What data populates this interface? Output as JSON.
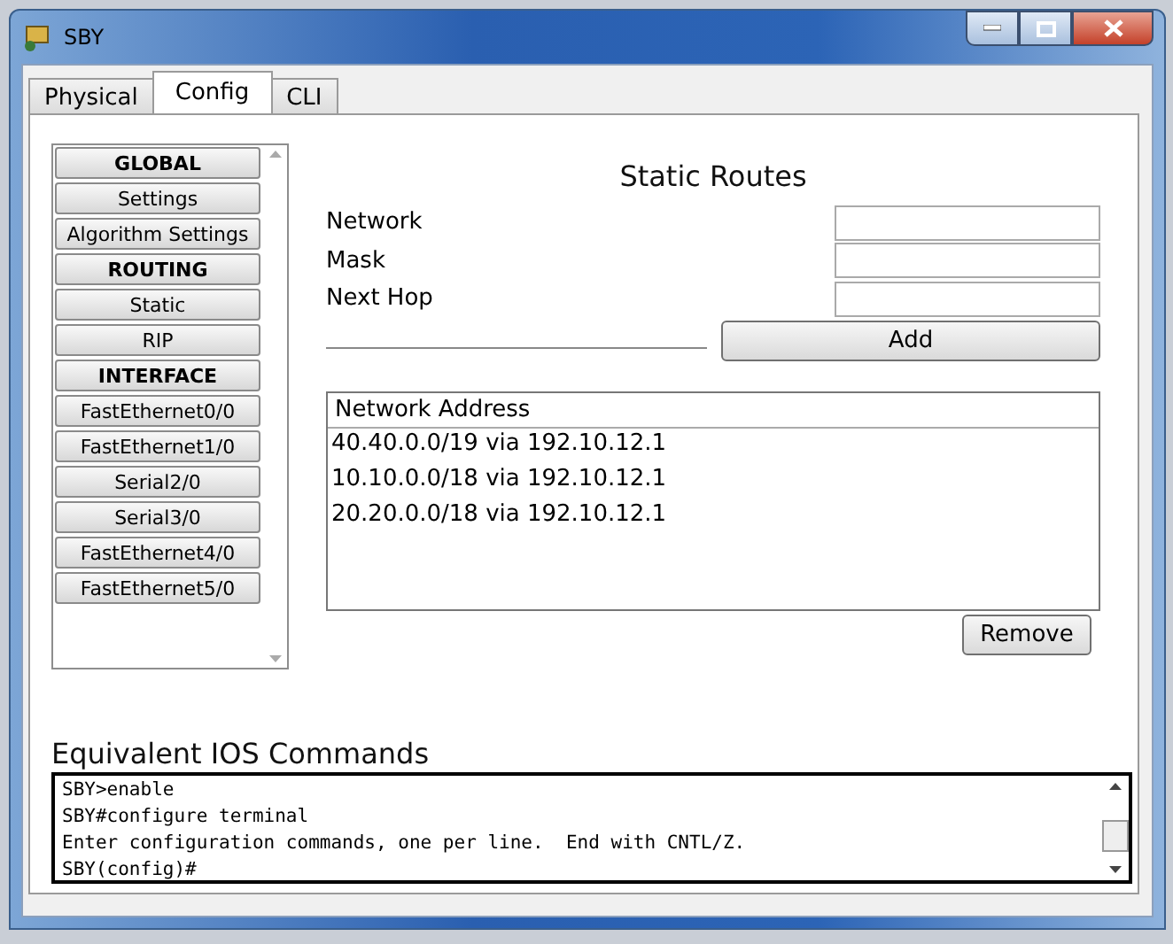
{
  "window": {
    "title": "SBY"
  },
  "tabs": [
    {
      "label": "Physical",
      "selected": false
    },
    {
      "label": "Config",
      "selected": true
    },
    {
      "label": "CLI",
      "selected": false
    }
  ],
  "sidebar": {
    "items": [
      {
        "kind": "header",
        "label": "GLOBAL"
      },
      {
        "kind": "item",
        "label": "Settings"
      },
      {
        "kind": "item",
        "label": "Algorithm Settings"
      },
      {
        "kind": "header",
        "label": "ROUTING"
      },
      {
        "kind": "item",
        "label": "Static"
      },
      {
        "kind": "item",
        "label": "RIP"
      },
      {
        "kind": "header",
        "label": "INTERFACE"
      },
      {
        "kind": "item",
        "label": "FastEthernet0/0"
      },
      {
        "kind": "item",
        "label": "FastEthernet1/0"
      },
      {
        "kind": "item",
        "label": "Serial2/0"
      },
      {
        "kind": "item",
        "label": "Serial3/0"
      },
      {
        "kind": "item",
        "label": "FastEthernet4/0"
      },
      {
        "kind": "item",
        "label": "FastEthernet5/0"
      }
    ]
  },
  "static_routes": {
    "title": "Static Routes",
    "fields": [
      {
        "label": "Network"
      },
      {
        "label": "Mask"
      },
      {
        "label": "Next Hop"
      }
    ],
    "add_button": "Add",
    "list": {
      "header": "Network Address",
      "rows": [
        "40.40.0.0/19 via 192.10.12.1",
        "10.10.0.0/18 via 192.10.12.1",
        "20.20.0.0/18 via 192.10.12.1"
      ]
    },
    "remove_button": "Remove"
  },
  "ios_commands": {
    "title": "Equivalent IOS Commands",
    "lines": [
      "SBY>enable",
      "SBY#configure terminal",
      "Enter configuration commands, one per line.  End with CNTL/Z.",
      "SBY(config)#"
    ]
  }
}
